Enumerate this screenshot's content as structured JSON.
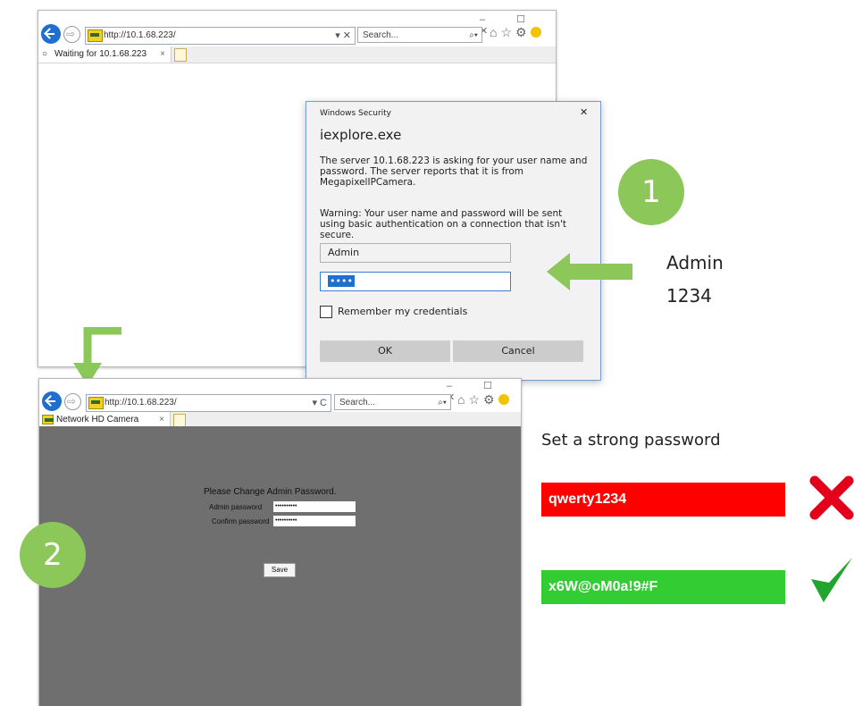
{
  "browser_top": {
    "url": "http://10.1.68.223/",
    "url_action": "▾ ✕",
    "search_placeholder": "Search...",
    "tab_title": "Waiting for 10.1.68.223",
    "tab_close": "×",
    "window_controls": "–  ☐  ✕"
  },
  "dialog": {
    "titlebar": "Windows Security",
    "close": "✕",
    "app": "iexplore.exe",
    "message": "The server 10.1.68.223 is asking for your user name and password. The server reports that it is from MegapixelIPCamera.",
    "warning": "Warning: Your user name and password will be sent using basic authentication on a connection that isn't secure.",
    "username_value": "Admin",
    "password_value": "••••",
    "remember_label": "Remember my credentials",
    "ok_label": "OK",
    "cancel_label": "Cancel"
  },
  "annotation_1": {
    "badge": "1",
    "username": "Admin",
    "password": "1234"
  },
  "browser_bottom": {
    "url": "http://10.1.68.223/",
    "url_action": "▾ C",
    "search_placeholder": "Search...",
    "tab_title": "Network HD Camera",
    "tab_close": "×",
    "window_controls": "–  ☐  ✕",
    "page": {
      "heading": "Please Change Admin Password.",
      "admin_label": "Admin password",
      "admin_value": "••••••••••",
      "confirm_label": "Confirm password",
      "confirm_value": "••••••••••",
      "save_label": "Save"
    }
  },
  "annotation_2": {
    "badge": "2",
    "title": "Set a strong password",
    "weak_example": "qwerty1234",
    "strong_example": "x6W@oM0a!9#F",
    "weak_color": "#ff0000",
    "strong_color": "#33cc33"
  }
}
